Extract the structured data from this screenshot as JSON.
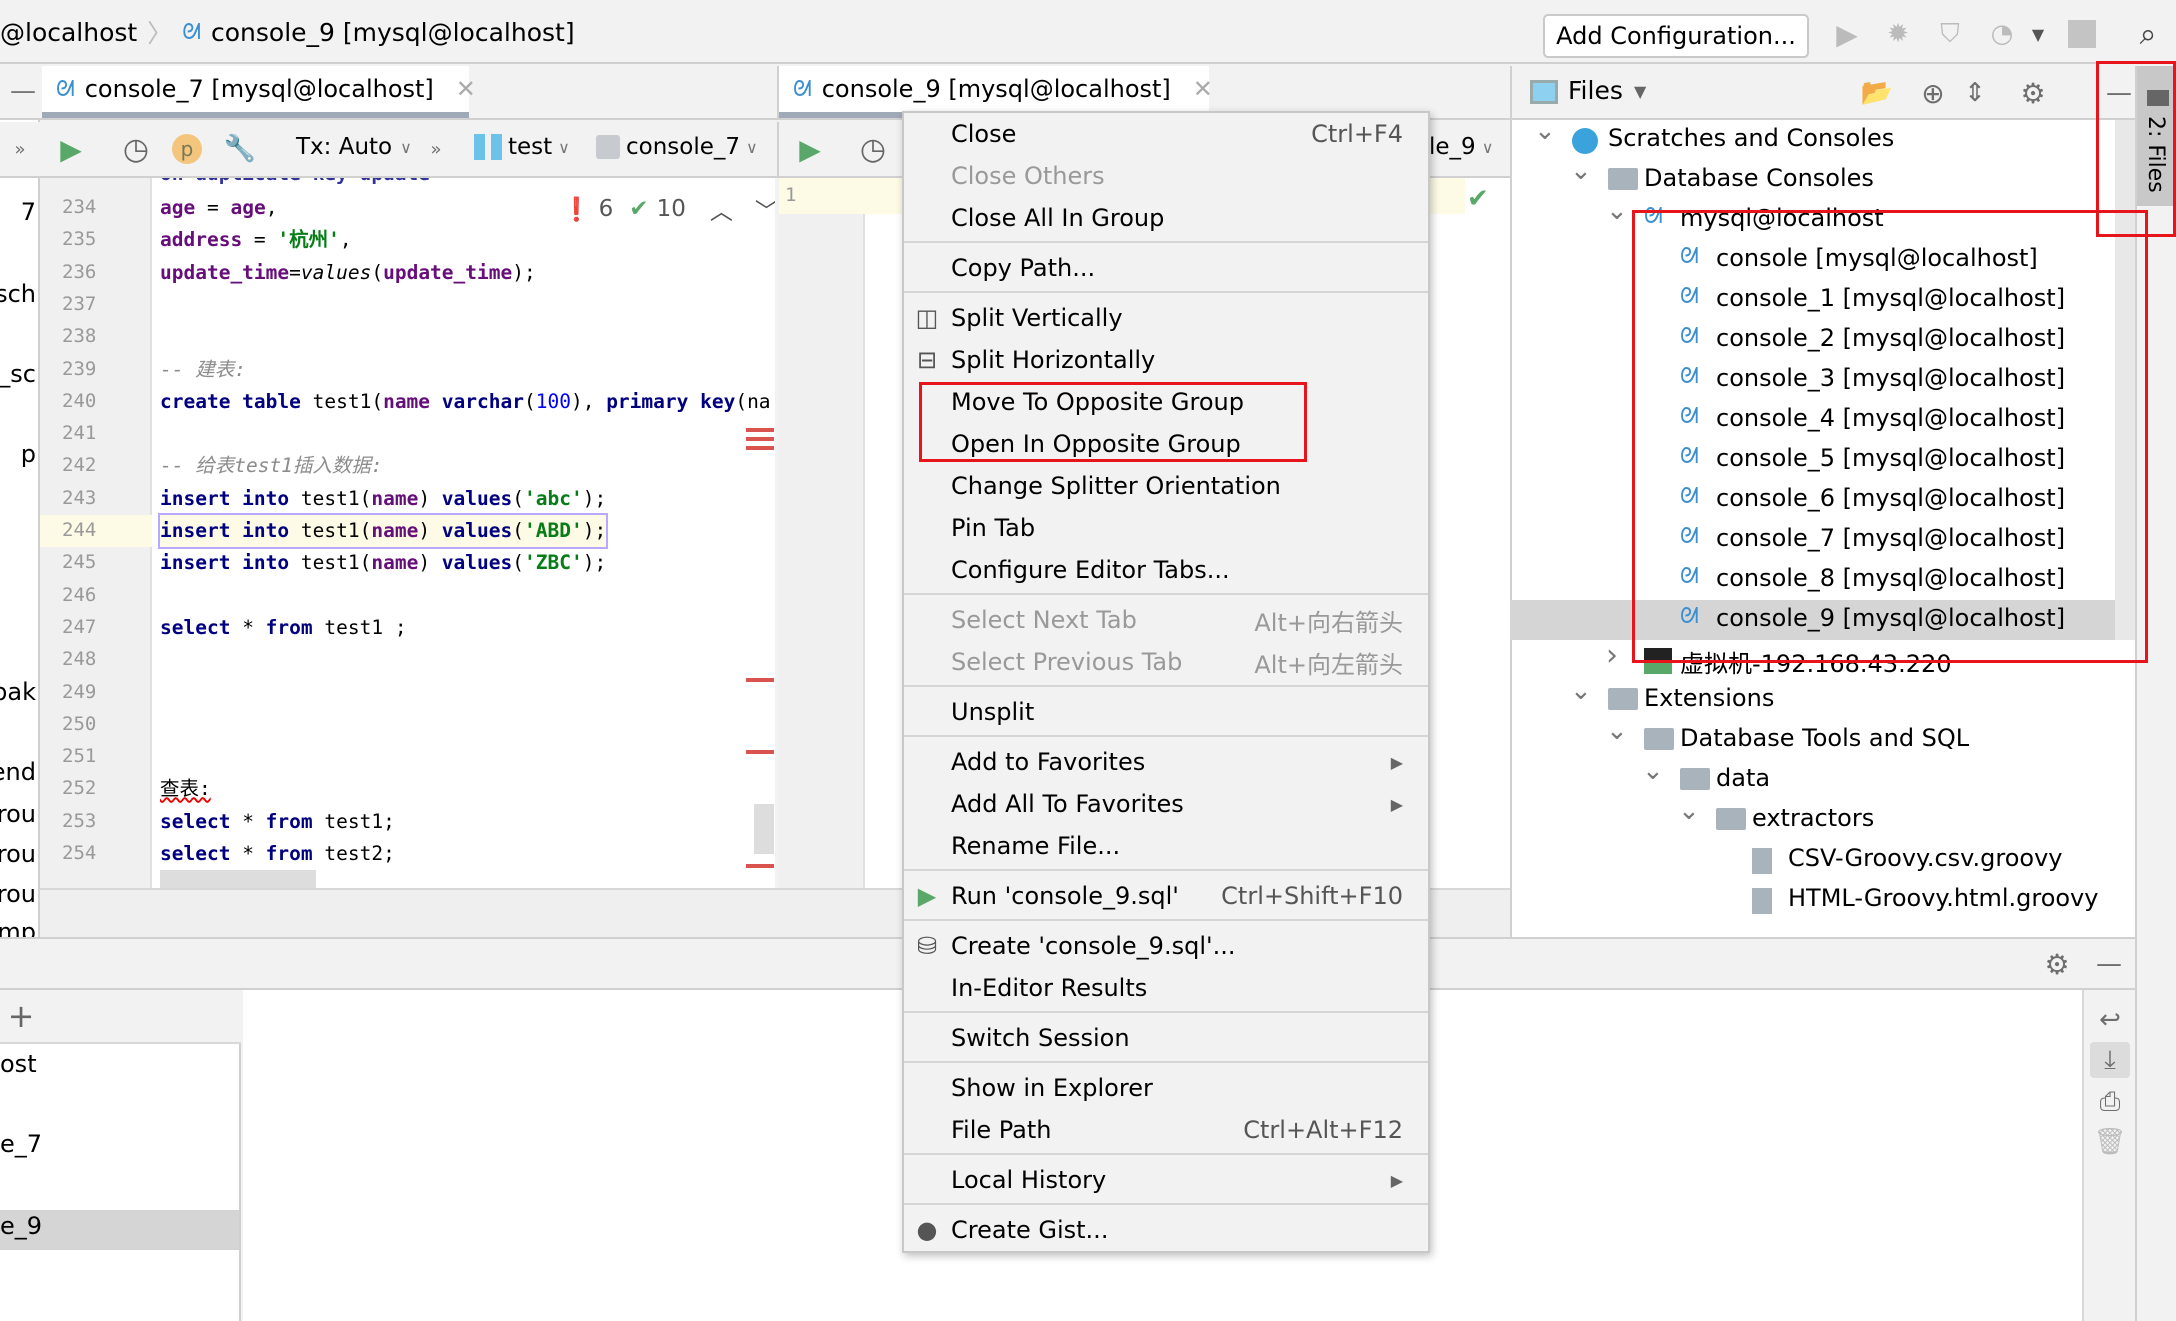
{
  "breadcrumb": {
    "parent": "@localhost",
    "separator": "〉",
    "current": "console_9 [mysql@localhost]"
  },
  "toolbar": {
    "add_configuration": "Add Configuration..."
  },
  "left_editor": {
    "tab": "console_7 [mysql@localhost]",
    "tx_mode": "Tx: Auto",
    "schema": "test",
    "session": "console_7",
    "badge_p": "p",
    "inspections": {
      "errors": "6",
      "warnings": "10"
    },
    "line_numbers": [
      "234",
      "235",
      "236",
      "237",
      "238",
      "239",
      "240",
      "241",
      "242",
      "243",
      "244",
      "245",
      "246",
      "247",
      "248",
      "249",
      "250",
      "251",
      "252",
      "253",
      "254"
    ],
    "current_line": "244",
    "lines": [
      [
        [
          "id",
          "age"
        ],
        [
          "pl",
          " = "
        ],
        [
          "id",
          "age"
        ],
        [
          "pl",
          ","
        ]
      ],
      [
        [
          "id",
          "address"
        ],
        [
          "pl",
          " = "
        ],
        [
          "st",
          "'杭州'"
        ],
        [
          "pl",
          ","
        ]
      ],
      [
        [
          "id",
          "update_time"
        ],
        [
          "pl",
          "="
        ],
        [
          "fn",
          "values"
        ],
        [
          "pl",
          "("
        ],
        [
          "id",
          "update_time"
        ],
        [
          "pl",
          ");"
        ]
      ],
      [],
      [],
      [
        [
          "cm",
          "-- 建表:"
        ]
      ],
      [
        [
          "kw",
          "create table "
        ],
        [
          "pl",
          "test1("
        ],
        [
          "id",
          "name "
        ],
        [
          "kw",
          "varchar"
        ],
        [
          "pl",
          "("
        ],
        [
          "nm",
          "100"
        ],
        [
          "pl",
          "), "
        ],
        [
          "kw",
          "primary key"
        ],
        [
          "pl",
          "(na"
        ]
      ],
      [],
      [
        [
          "cm",
          "-- 给表test1插入数据:"
        ]
      ],
      [
        [
          "kw",
          "insert into "
        ],
        [
          "pl",
          "test1("
        ],
        [
          "id",
          "name"
        ],
        [
          "pl",
          ") "
        ],
        [
          "kw",
          "values"
        ],
        [
          "pl",
          "("
        ],
        [
          "st",
          "'abc'"
        ],
        [
          "pl",
          ");"
        ]
      ],
      [
        [
          "kw",
          "insert into "
        ],
        [
          "pl",
          "test1("
        ],
        [
          "id",
          "name"
        ],
        [
          "pl",
          ") "
        ],
        [
          "kw",
          "values"
        ],
        [
          "pl",
          "("
        ],
        [
          "st",
          "'ABD'"
        ],
        [
          "pl",
          ");"
        ]
      ],
      [
        [
          "kw",
          "insert into "
        ],
        [
          "pl",
          "test1("
        ],
        [
          "id",
          "name"
        ],
        [
          "pl",
          ") "
        ],
        [
          "kw",
          "values"
        ],
        [
          "pl",
          "("
        ],
        [
          "st",
          "'ZBC'"
        ],
        [
          "pl",
          ");"
        ]
      ],
      [],
      [
        [
          "kw",
          "select "
        ],
        [
          "pl",
          "* "
        ],
        [
          "kw",
          "from "
        ],
        [
          "pl",
          "test1 ;"
        ]
      ],
      [],
      [],
      [],
      [],
      [
        [
          "cn",
          "查表:"
        ]
      ],
      [
        [
          "kw",
          "select "
        ],
        [
          "pl",
          "* "
        ],
        [
          "kw",
          "from "
        ],
        [
          "pl",
          "test1;"
        ]
      ],
      [
        [
          "kw",
          "select "
        ],
        [
          "pl",
          "* "
        ],
        [
          "kw",
          "from "
        ],
        [
          "pl",
          "test2;"
        ]
      ]
    ]
  },
  "right_editor": {
    "tab": "console_9 [mysql@localhost]",
    "line_numbers": [
      "1"
    ],
    "session_partial": "le_9"
  },
  "project_partial": [
    "7",
    "_sch",
    "e_sc",
    "p",
    "bak",
    "end",
    "grou",
    "grou",
    "grou",
    "mp"
  ],
  "context_menu": [
    {
      "label": "Close",
      "shortcut": "Ctrl+F4"
    },
    {
      "label": "Close Others",
      "disabled": true
    },
    {
      "label": "Close All In Group"
    },
    {
      "sep": true
    },
    {
      "label": "Copy Path..."
    },
    {
      "sep": true
    },
    {
      "label": "Split Vertically",
      "icon": "split-vertical-icon"
    },
    {
      "label": "Split Horizontally",
      "icon": "split-horizontal-icon"
    },
    {
      "label": "Move To Opposite Group"
    },
    {
      "label": "Open In Opposite Group"
    },
    {
      "label": "Change Splitter Orientation"
    },
    {
      "label": "Pin Tab"
    },
    {
      "label": "Configure Editor Tabs..."
    },
    {
      "sep": true
    },
    {
      "label": "Select Next Tab",
      "shortcut": "Alt+向右箭头",
      "disabled": true
    },
    {
      "label": "Select Previous Tab",
      "shortcut": "Alt+向左箭头",
      "disabled": true
    },
    {
      "sep": true
    },
    {
      "label": "Unsplit"
    },
    {
      "sep": true
    },
    {
      "label": "Add to Favorites",
      "submenu": true
    },
    {
      "label": "Add All To Favorites",
      "submenu": true
    },
    {
      "label": "Rename File..."
    },
    {
      "sep": true
    },
    {
      "label": "Run 'console_9.sql'",
      "shortcut": "Ctrl+Shift+F10",
      "icon": "run-icon"
    },
    {
      "sep": true
    },
    {
      "label": "Create 'console_9.sql'...",
      "icon": "database-run-icon"
    },
    {
      "label": "In-Editor Results"
    },
    {
      "sep": true
    },
    {
      "label": "Switch Session"
    },
    {
      "sep": true
    },
    {
      "label": "Show in Explorer"
    },
    {
      "label": "File Path",
      "shortcut": "Ctrl+Alt+F12"
    },
    {
      "sep": true
    },
    {
      "label": "Local History",
      "submenu": true
    },
    {
      "sep": true
    },
    {
      "label": "Create Gist...",
      "icon": "github-icon"
    }
  ],
  "files_panel": {
    "title": "Files",
    "side_tab": "2: Files",
    "tree": [
      {
        "label": "Scratches and Consoles",
        "level": 0,
        "expanded": true,
        "icon": "scratches-icon"
      },
      {
        "label": "Database Consoles",
        "level": 1,
        "expanded": true,
        "icon": "folder-icon"
      },
      {
        "label": "mysql@localhost",
        "level": 2,
        "expanded": true,
        "icon": "mysql-icon"
      },
      {
        "label": "console [mysql@localhost]",
        "level": 3,
        "icon": "mysql-icon"
      },
      {
        "label": "console_1 [mysql@localhost]",
        "level": 3,
        "icon": "mysql-icon"
      },
      {
        "label": "console_2 [mysql@localhost]",
        "level": 3,
        "icon": "mysql-icon"
      },
      {
        "label": "console_3 [mysql@localhost]",
        "level": 3,
        "icon": "mysql-icon"
      },
      {
        "label": "console_4 [mysql@localhost]",
        "level": 3,
        "icon": "mysql-icon"
      },
      {
        "label": "console_5 [mysql@localhost]",
        "level": 3,
        "icon": "mysql-icon"
      },
      {
        "label": "console_6 [mysql@localhost]",
        "level": 3,
        "icon": "mysql-icon"
      },
      {
        "label": "console_7 [mysql@localhost]",
        "level": 3,
        "icon": "mysql-icon"
      },
      {
        "label": "console_8 [mysql@localhost]",
        "level": 3,
        "icon": "mysql-icon"
      },
      {
        "label": "console_9 [mysql@localhost]",
        "level": 3,
        "icon": "mysql-icon",
        "selected": true
      },
      {
        "label": "虚拟机-192.168.43.220",
        "level": 2,
        "expanded": false,
        "icon": "db2-icon"
      },
      {
        "label": "Extensions",
        "level": 1,
        "expanded": true,
        "icon": "folder-icon"
      },
      {
        "label": "Database Tools and SQL",
        "level": 2,
        "expanded": true,
        "icon": "folder-icon"
      },
      {
        "label": "data",
        "level": 3,
        "expanded": true,
        "icon": "folder-icon"
      },
      {
        "label": "extractors",
        "level": 4,
        "expanded": true,
        "icon": "folder-icon"
      },
      {
        "label": "CSV-Groovy.csv.groovy",
        "level": 5,
        "icon": "file-icon"
      },
      {
        "label": "HTML-Groovy.html.groovy",
        "level": 5,
        "icon": "file-icon"
      }
    ]
  },
  "services": {
    "items": [
      "ost",
      "e_7",
      "e_9"
    ],
    "selected": "e_9"
  },
  "colors": {
    "highlight": "#e8141c",
    "selection": "#d5d5d5",
    "run": "#59a869",
    "current_line": "#fdfbe6"
  }
}
